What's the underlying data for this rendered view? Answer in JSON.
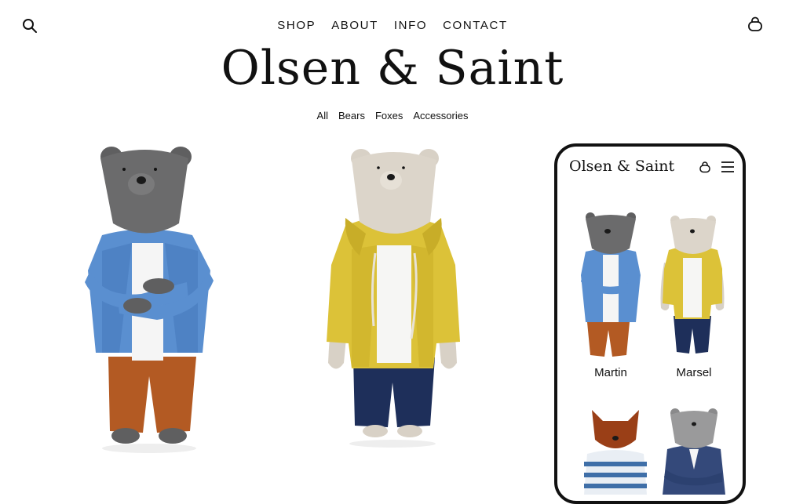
{
  "header": {
    "search_icon": "search-icon",
    "bag_icon": "bag-icon",
    "nav": [
      {
        "label": "SHOP"
      },
      {
        "label": "ABOUT"
      },
      {
        "label": "INFO"
      },
      {
        "label": "CONTACT"
      }
    ],
    "logo": "Olsen & Saint"
  },
  "filters": [
    {
      "label": "All"
    },
    {
      "label": "Bears"
    },
    {
      "label": "Foxes"
    },
    {
      "label": "Accessories"
    }
  ],
  "phone": {
    "logo": "Olsen & Saint",
    "bag_icon": "bag-icon",
    "menu_icon": "hamburger-menu-icon",
    "products": [
      {
        "name": "Martin"
      },
      {
        "name": "Marsel"
      }
    ]
  },
  "colors": {
    "text": "#111111",
    "background": "#ffffff",
    "grey_bear": "#5f5f60",
    "beige_bear": "#d8d1c6",
    "blue_cardigan": "#5a8fd0",
    "rust_pants": "#b35a23",
    "yellow_jacket": "#dcc238",
    "navy_pants": "#1e2f5a",
    "fox": "#9a3f17"
  }
}
